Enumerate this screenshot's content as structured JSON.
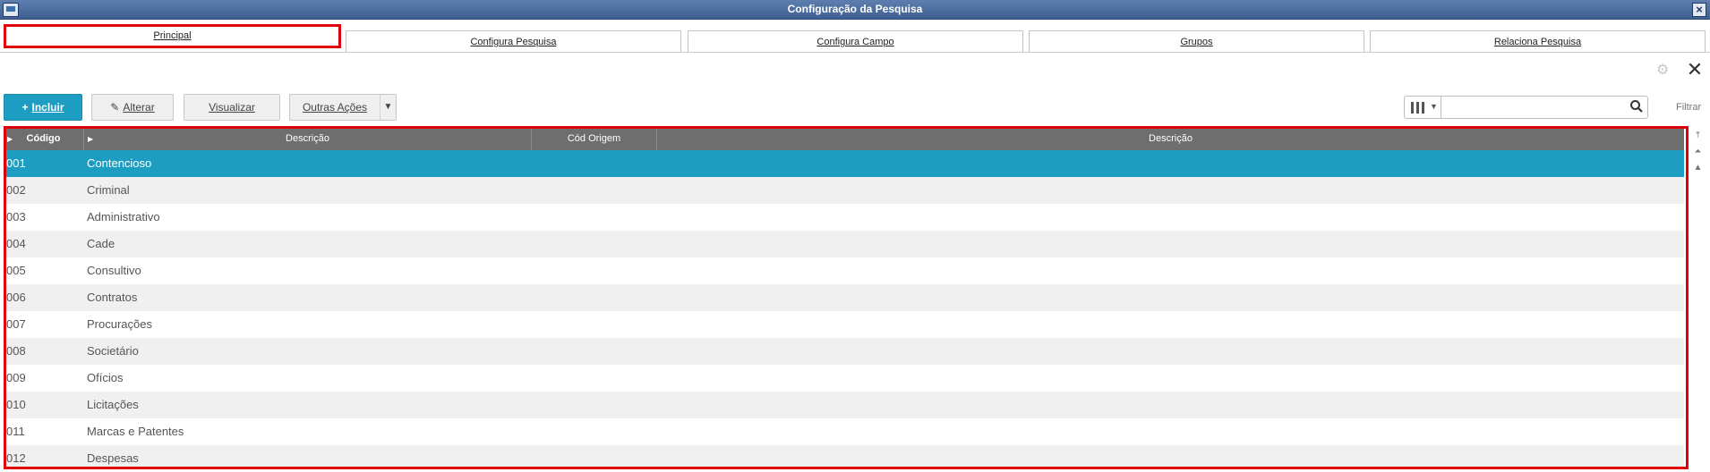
{
  "window": {
    "title": "Configuração da Pesquisa",
    "close_label": "×"
  },
  "tabs": [
    {
      "label": "Principal",
      "active": true
    },
    {
      "label": "Configura Pesquisa"
    },
    {
      "label": "Configura Campo"
    },
    {
      "label": "Grupos"
    },
    {
      "label": "Relaciona Pesquisa"
    }
  ],
  "header_icons": {
    "settings": "gear-icon",
    "close": "close-icon",
    "close_glyph": "✕",
    "gear_glyph": "⚙"
  },
  "toolbar": {
    "incluir_label": "Incluir",
    "alterar_label": "Alterar",
    "visualizar_label": "Visualizar",
    "outras_acoes_label": "Outras Ações",
    "plus_glyph": "+",
    "pencil_glyph": "✎",
    "caret_glyph": "▼"
  },
  "search": {
    "value": "",
    "placeholder": "",
    "filter_label": "Filtrar"
  },
  "grid": {
    "columns": [
      "Código",
      "Descrição",
      "Cód Origem",
      "Descrição"
    ],
    "rows": [
      {
        "codigo": "001",
        "descricao": "Contencioso",
        "selected": true
      },
      {
        "codigo": "002",
        "descricao": "Criminal"
      },
      {
        "codigo": "003",
        "descricao": "Administrativo"
      },
      {
        "codigo": "004",
        "descricao": "Cade"
      },
      {
        "codigo": "005",
        "descricao": "Consultivo"
      },
      {
        "codigo": "006",
        "descricao": "Contratos"
      },
      {
        "codigo": "007",
        "descricao": "Procurações"
      },
      {
        "codigo": "008",
        "descricao": "Societário"
      },
      {
        "codigo": "009",
        "descricao": "Ofícios"
      },
      {
        "codigo": "010",
        "descricao": "Licitações"
      },
      {
        "codigo": "011",
        "descricao": "Marcas e Patentes"
      },
      {
        "codigo": "012",
        "descricao": "Despesas"
      }
    ]
  },
  "colors": {
    "accent": "#1e9dc2",
    "highlight": "#e0000a",
    "header_bg": "#6e6e6e"
  }
}
